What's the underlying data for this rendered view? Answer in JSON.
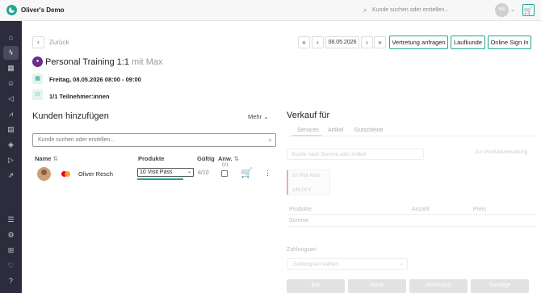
{
  "app": {
    "studio_name": "Oliver's Demo",
    "search_placeholder": "Kunde suchen oder erstellen...",
    "avatar_initials": "M8"
  },
  "sidebar": {
    "items": [
      {
        "icon": "home-icon"
      },
      {
        "icon": "lightning-icon",
        "active": true
      },
      {
        "icon": "calendar-icon"
      },
      {
        "icon": "person-icon"
      },
      {
        "icon": "megaphone-icon"
      },
      {
        "icon": "chart-icon"
      },
      {
        "icon": "clipboard-icon"
      },
      {
        "icon": "box-icon"
      },
      {
        "icon": "play-circle-icon"
      },
      {
        "icon": "rocket-icon"
      },
      {
        "icon": "list-icon"
      },
      {
        "icon": "gear-icon"
      },
      {
        "icon": "plus-square-icon"
      },
      {
        "icon": "heart-icon"
      },
      {
        "icon": "help-icon"
      }
    ]
  },
  "header": {
    "back_label": "Zurück",
    "date": "08.05.2026",
    "btn_vertretung": "Vertretung anfragen",
    "btn_laufkunde": "Laufkunde",
    "btn_signin": "Online Sign In"
  },
  "event": {
    "badge": "",
    "title": "Personal Training 1:1",
    "title_sub": "mit Max",
    "datetime": "Freitag, 08.05.2026 08:00 - 09:00",
    "participants": "1/1 Teilnehmer:innen"
  },
  "customers": {
    "title": "Kunden hinzufügen",
    "more_label": "Mehr",
    "search_placeholder": "Kunde suchen oder erstellen...",
    "columns": {
      "name": "Name",
      "products": "Produkte",
      "valid": "Gültig",
      "attendance": "Anw.",
      "attendance_count": "0/1"
    },
    "rows": [
      {
        "name": "Oliver Resch",
        "product": "10 Visit Pass",
        "valid": "8/10",
        "checked": false
      }
    ]
  },
  "sale": {
    "title": "Verkauf für",
    "tabs": [
      "Services",
      "Artikel",
      "Gutscheine"
    ],
    "search_placeholder": "Suche nach Service oder Artikel",
    "product_link": "Zur Produktverwaltung",
    "card": {
      "name": "10 Visit Pass",
      "price": "140,00 €"
    },
    "columns": {
      "products": "Produkte",
      "quantity": "Anzahl",
      "price": "Preis"
    },
    "sum_label": "Summe",
    "payment_label": "Zahlungsart",
    "payment_placeholder": "Zahlungsart wählen",
    "buttons": [
      "Bar",
      "Karte",
      "Rechnung",
      "Sonstige"
    ]
  },
  "colors": {
    "accent": "#1ea890",
    "sidebar": "#2c2c3c",
    "badge": "#6b2d8c"
  }
}
